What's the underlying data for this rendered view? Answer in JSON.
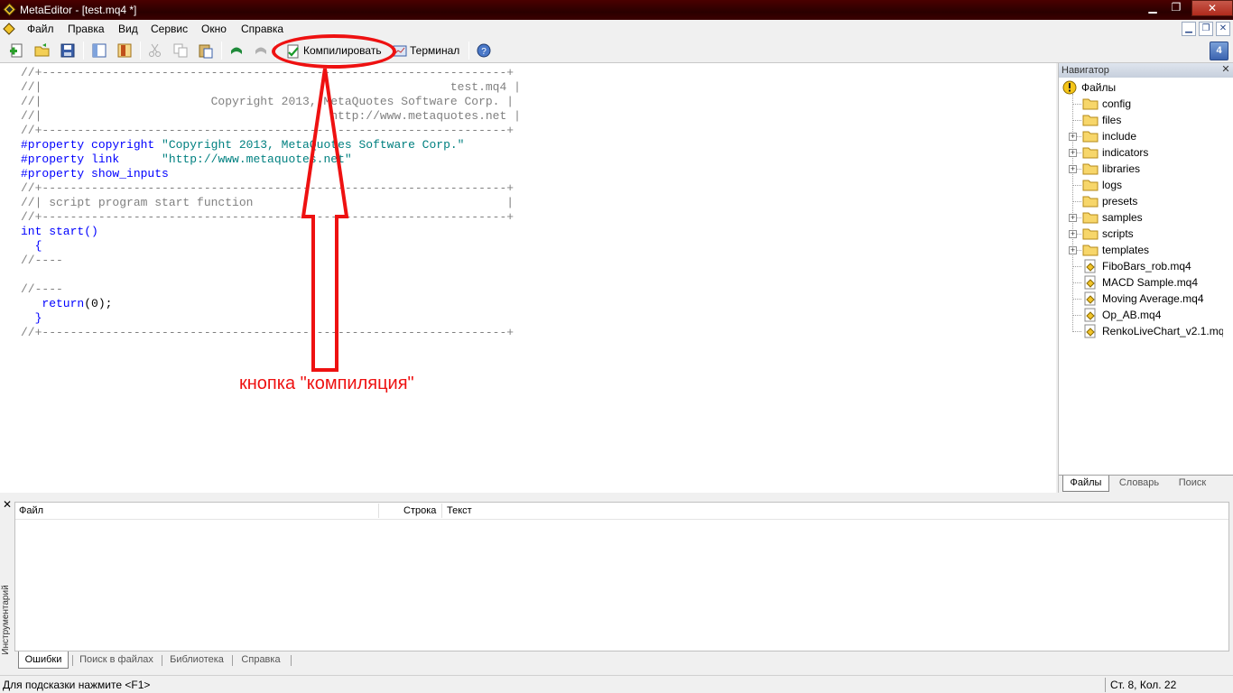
{
  "window": {
    "title": "MetaEditor - [test.mq4 *]",
    "controls": [
      "▁",
      "❐",
      "✕"
    ]
  },
  "menu": {
    "items": [
      "Файл",
      "Правка",
      "Вид",
      "Сервис",
      "Окно",
      "Справка"
    ],
    "mdi_controls": [
      "▁",
      "❐",
      "✕"
    ]
  },
  "toolbar": {
    "compile_label": "Компилировать",
    "terminal_label": "Терминал",
    "help_badge": "4"
  },
  "editor": {
    "lines": [
      [
        {
          "t": "//+------------------------------------------------------------------+",
          "c": "gray"
        }
      ],
      [
        {
          "t": "//|                                                          test.mq4 |",
          "c": "gray"
        }
      ],
      [
        {
          "t": "//|                        Copyright 2013, MetaQuotes Software Corp. |",
          "c": "gray"
        }
      ],
      [
        {
          "t": "//|                                         http://www.metaquotes.net |",
          "c": "gray"
        }
      ],
      [
        {
          "t": "//+------------------------------------------------------------------+",
          "c": "gray"
        }
      ],
      [
        {
          "t": "#property copyright ",
          "c": "blue"
        },
        {
          "t": "\"Copyright 2013, MetaQuotes Software Corp.\"",
          "c": "teal"
        }
      ],
      [
        {
          "t": "#property link      ",
          "c": "blue"
        },
        {
          "t": "\"http://www.metaquotes.net\"",
          "c": "teal"
        }
      ],
      [
        {
          "t": "#property show_inputs",
          "c": "blue"
        }
      ],
      [
        {
          "t": "//+------------------------------------------------------------------+",
          "c": "gray"
        }
      ],
      [
        {
          "t": "//| script program start function                                    |",
          "c": "gray"
        }
      ],
      [
        {
          "t": "//+------------------------------------------------------------------+",
          "c": "gray"
        }
      ],
      [
        {
          "t": "int",
          "c": "blue"
        },
        {
          "t": " start()",
          "c": "blue"
        }
      ],
      [
        {
          "t": "  {",
          "c": "blue"
        }
      ],
      [
        {
          "t": "//----",
          "c": "gray"
        }
      ],
      [
        {
          "t": "",
          "c": "black"
        }
      ],
      [
        {
          "t": "//----",
          "c": "gray"
        }
      ],
      [
        {
          "t": "   return",
          "c": "blue"
        },
        {
          "t": "(0);",
          "c": "black"
        }
      ],
      [
        {
          "t": "  }",
          "c": "blue"
        }
      ],
      [
        {
          "t": "//+------------------------------------------------------------------+",
          "c": "gray"
        }
      ]
    ]
  },
  "annotation": {
    "label": "кнопка \"компиляция\""
  },
  "navigator": {
    "header": "Навигатор",
    "root": "Файлы",
    "items": [
      {
        "label": "config",
        "type": "folder",
        "expandable": false
      },
      {
        "label": "files",
        "type": "folder",
        "expandable": false
      },
      {
        "label": "include",
        "type": "folder",
        "expandable": true
      },
      {
        "label": "indicators",
        "type": "folder",
        "expandable": true
      },
      {
        "label": "libraries",
        "type": "folder",
        "expandable": true
      },
      {
        "label": "logs",
        "type": "folder",
        "expandable": false
      },
      {
        "label": "presets",
        "type": "folder",
        "expandable": false
      },
      {
        "label": "samples",
        "type": "folder",
        "expandable": true
      },
      {
        "label": "scripts",
        "type": "folder",
        "expandable": true
      },
      {
        "label": "templates",
        "type": "folder",
        "expandable": true
      },
      {
        "label": "FiboBars_rob.mq4",
        "type": "file",
        "expandable": false
      },
      {
        "label": "MACD Sample.mq4",
        "type": "file",
        "expandable": false
      },
      {
        "label": "Moving Average.mq4",
        "type": "file",
        "expandable": false
      },
      {
        "label": "Op_AB.mq4",
        "type": "file",
        "expandable": false
      },
      {
        "label": "RenkoLiveChart_v2.1.mq4",
        "type": "file",
        "expandable": false
      }
    ],
    "tabs": [
      "Файлы",
      "Словарь",
      "Поиск"
    ],
    "active_tab": 0
  },
  "toolbox": {
    "side_label": "Инструментарий",
    "close": "✕",
    "columns": [
      "Файл",
      "Строка",
      "Текст"
    ],
    "tabs": [
      "Ошибки",
      "Поиск в файлах",
      "Библиотека",
      "Справка"
    ],
    "active_tab": 0
  },
  "status": {
    "hint": "Для подсказки нажмите <F1>",
    "position": "Ст. 8, Кол. 22"
  },
  "colors": {
    "annotation": "#ee1111",
    "code_comment": "#808080",
    "code_keyword": "#0000ff",
    "code_string": "#008080"
  }
}
